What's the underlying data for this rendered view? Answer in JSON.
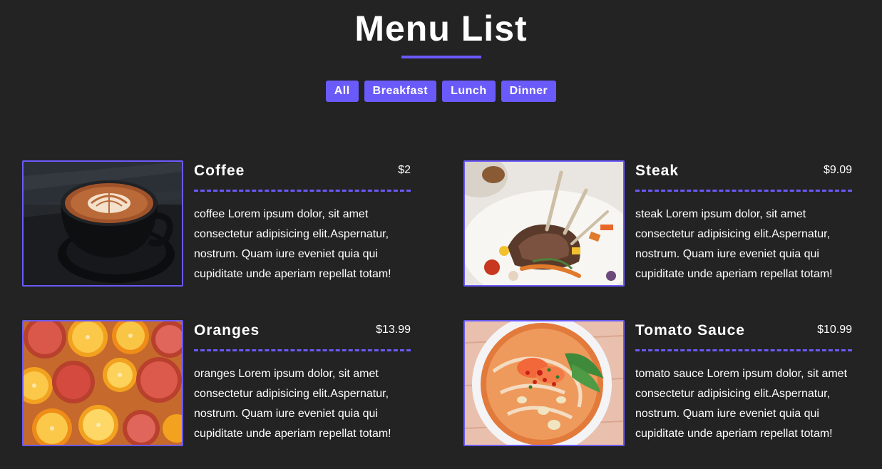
{
  "header": {
    "title": "Menu List"
  },
  "filters": [
    {
      "label": "All"
    },
    {
      "label": "Breakfast"
    },
    {
      "label": "Lunch"
    },
    {
      "label": "Dinner"
    }
  ],
  "items": [
    {
      "name": "Coffee",
      "price": "$2",
      "image": "coffee-image",
      "desc": "coffee Lorem ipsum dolor, sit amet consectetur adipisicing elit.Aspernatur, nostrum. Quam iure eveniet quia qui cupiditate unde aperiam repellat totam!"
    },
    {
      "name": "Steak",
      "price": "$9.09",
      "image": "steak-image",
      "desc": "steak Lorem ipsum dolor, sit amet consectetur adipisicing elit.Aspernatur, nostrum. Quam iure eveniet quia qui cupiditate unde aperiam repellat totam!"
    },
    {
      "name": "Oranges",
      "price": "$13.99",
      "image": "oranges-image",
      "desc": "oranges Lorem ipsum dolor, sit amet consectetur adipisicing elit.Aspernatur, nostrum. Quam iure eveniet quia qui cupiditate unde aperiam repellat totam!"
    },
    {
      "name": "Tomato Sauce",
      "price": "$10.99",
      "image": "tomato-sauce-image",
      "desc": "tomato sauce Lorem ipsum dolor, sit amet consectetur adipisicing elit.Aspernatur, nostrum. Quam iure eveniet quia qui cupiditate unde aperiam repellat totam!"
    }
  ],
  "colors": {
    "background": "#232323",
    "accent": "#6a5af9",
    "text": "#ffffff"
  }
}
